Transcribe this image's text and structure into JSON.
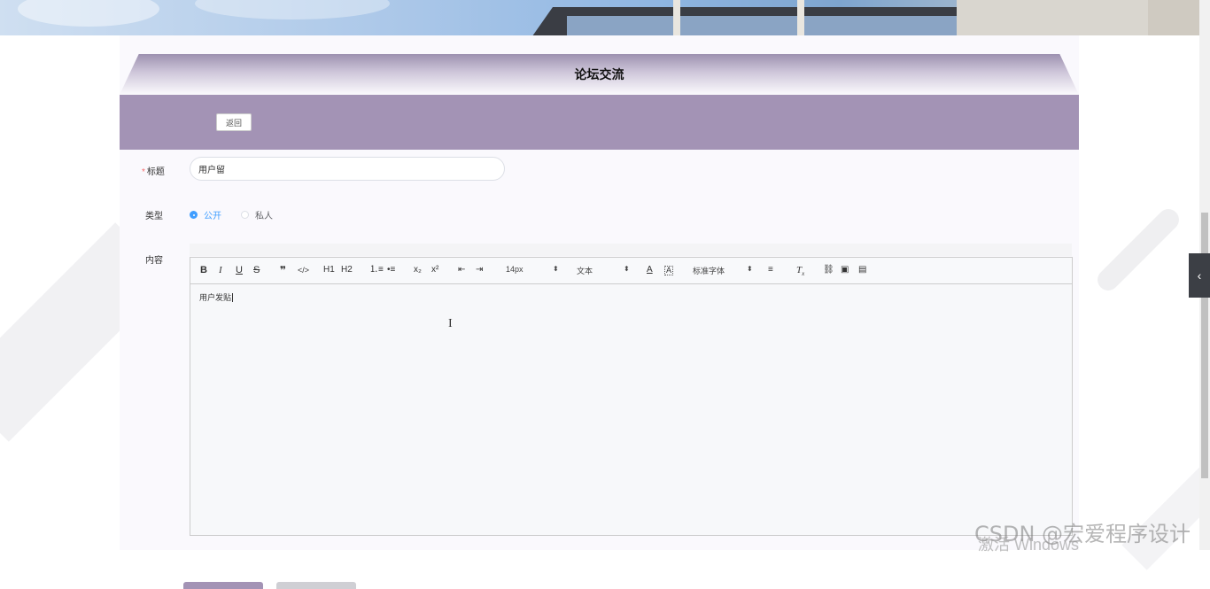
{
  "page": {
    "title": "论坛交流",
    "back_label": "返回"
  },
  "form": {
    "title_label": "标题",
    "title_value": "用户留",
    "type_label": "类型",
    "type_options": [
      {
        "label": "公开",
        "checked": true
      },
      {
        "label": "私人",
        "checked": false
      }
    ],
    "content_label": "内容",
    "content_value": "用户发贴"
  },
  "toolbar": {
    "buttons": [
      "B",
      "I",
      "U",
      "S",
      "❞",
      "</>",
      "H1",
      "H2",
      "ordered-list",
      "bullet-list",
      "x₂",
      "x²",
      "outdent",
      "indent",
      "text-color",
      "background-color",
      "align",
      "clear-format",
      "link",
      "image",
      "video"
    ],
    "size_select": "14px",
    "header_select": "文本",
    "font_select": "标准字体"
  },
  "watermark": {
    "csdn": "CSDN @宏爱程序设计",
    "windows": "激活 Windows"
  },
  "colors": {
    "title_gradient_top": "#9d91b0",
    "action_bar": "#a393b5",
    "radio_active": "#409eff",
    "required": "#f56c6c"
  }
}
